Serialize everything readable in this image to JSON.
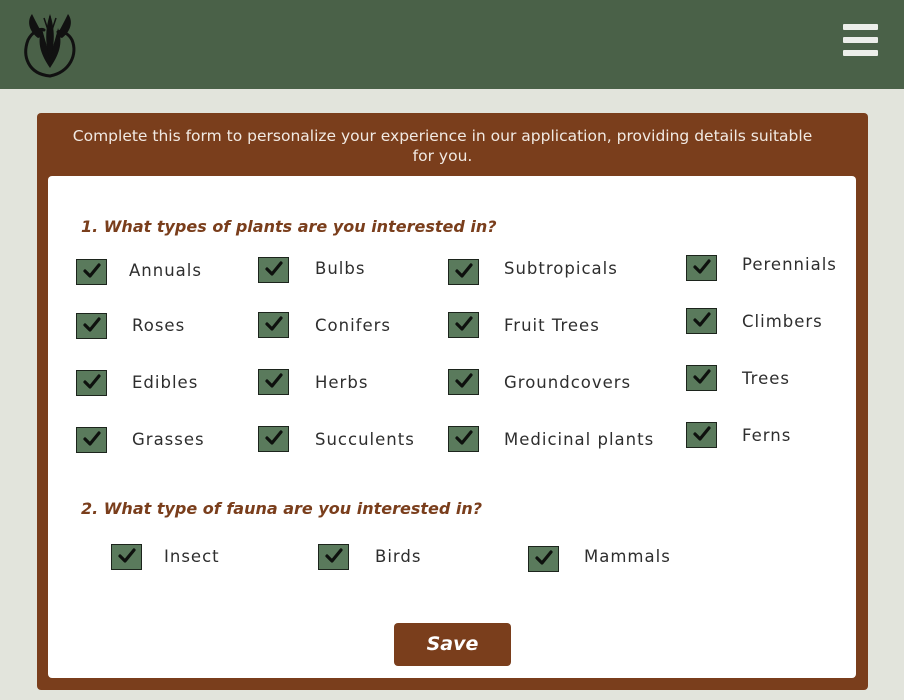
{
  "header": {
    "logo_icon": "lily-flower-logo-icon",
    "menu_icon": "hamburger-menu-icon"
  },
  "intro": "Complete this form to personalize your experience in our application, providing details suitable for you.",
  "plants": {
    "question": "1. What types of plants are you interested in?",
    "options": [
      {
        "label": "Annuals",
        "checked": true
      },
      {
        "label": "Bulbs",
        "checked": true
      },
      {
        "label": "Subtropicals",
        "checked": true
      },
      {
        "label": "Perennials",
        "checked": true
      },
      {
        "label": "Roses",
        "checked": true
      },
      {
        "label": "Conifers",
        "checked": true
      },
      {
        "label": "Fruit Trees",
        "checked": true
      },
      {
        "label": "Climbers",
        "checked": true
      },
      {
        "label": "Edibles",
        "checked": true
      },
      {
        "label": "Herbs",
        "checked": true
      },
      {
        "label": "Groundcovers",
        "checked": true
      },
      {
        "label": "Trees",
        "checked": true
      },
      {
        "label": "Grasses",
        "checked": true
      },
      {
        "label": "Succulents",
        "checked": true
      },
      {
        "label": "Medicinal plants",
        "checked": true
      },
      {
        "label": "Ferns",
        "checked": true
      }
    ]
  },
  "fauna": {
    "question": "2. What type of fauna are you interested in?",
    "options": [
      {
        "label": "Insect",
        "checked": true
      },
      {
        "label": "Birds",
        "checked": true
      },
      {
        "label": "Mammals",
        "checked": true
      }
    ]
  },
  "save_label": "Save",
  "colors": {
    "header": "#4a6148",
    "panel": "#7a3e1c",
    "checkbox": "#5a7a5c",
    "background": "#e2e4dc"
  }
}
